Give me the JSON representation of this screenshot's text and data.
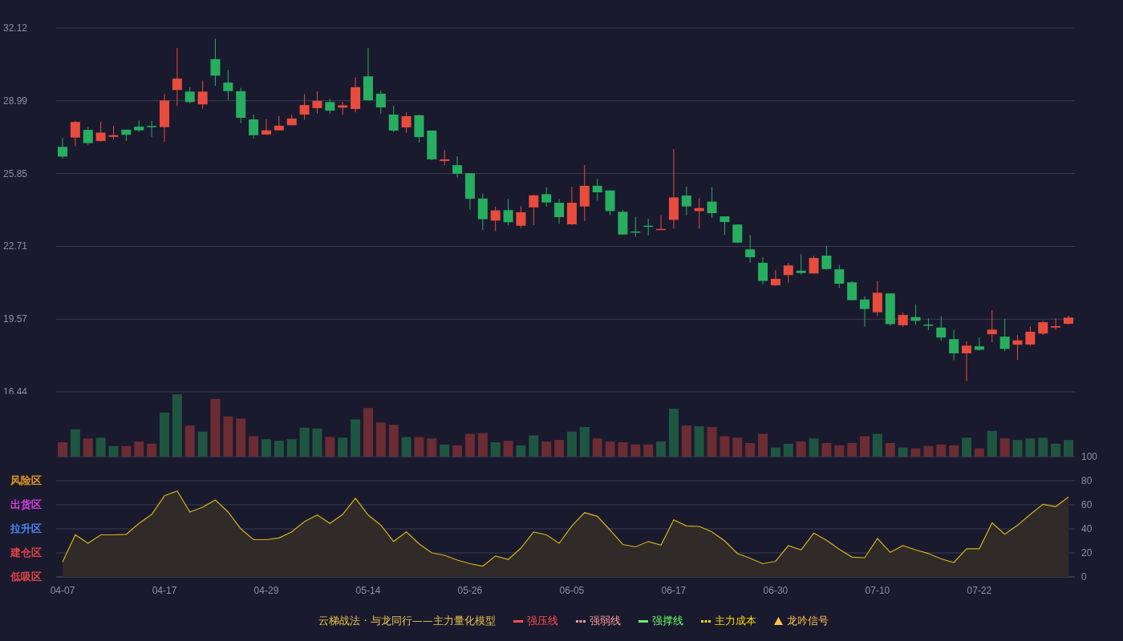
{
  "price_chart": {
    "chart_data": {
      "type": "candlestick",
      "grid": true,
      "ylim": [
        16.44,
        32.12
      ],
      "yticks": [
        32.12,
        28.99,
        25.85,
        22.71,
        19.57,
        16.44
      ],
      "categories": [
        null,
        null,
        null,
        null,
        null,
        null,
        null,
        null,
        null,
        null,
        null,
        null,
        null,
        null,
        null,
        null,
        null,
        null,
        null,
        null,
        null,
        null,
        null,
        null,
        null,
        null,
        null,
        null,
        null,
        null,
        null,
        null,
        null,
        null,
        null,
        null,
        null,
        null,
        null,
        null,
        null,
        null,
        null,
        null,
        null,
        null,
        null,
        null,
        null,
        null,
        null,
        null,
        null,
        null,
        null,
        null,
        null,
        null,
        null,
        null,
        null,
        null,
        null,
        null,
        null,
        null,
        null,
        null,
        null,
        null,
        null,
        null,
        null,
        null,
        null,
        null,
        null,
        null,
        null,
        null
      ],
      "ohlc": [
        [
          27.0,
          27.38,
          26.5,
          26.58
        ],
        [
          27.4,
          28.11,
          27.02,
          28.07
        ],
        [
          27.73,
          27.86,
          27.09,
          27.16
        ],
        [
          27.25,
          28.08,
          27.23,
          27.61
        ],
        [
          27.43,
          27.91,
          27.31,
          27.5
        ],
        [
          27.74,
          27.74,
          27.25,
          27.52
        ],
        [
          27.87,
          28.14,
          27.64,
          27.71
        ],
        [
          27.9,
          28.11,
          27.43,
          27.85
        ],
        [
          27.85,
          29.28,
          27.22,
          29.0
        ],
        [
          29.45,
          31.26,
          28.76,
          29.94
        ],
        [
          29.38,
          29.57,
          28.86,
          28.93
        ],
        [
          28.83,
          29.86,
          28.64,
          29.38
        ],
        [
          30.78,
          31.66,
          29.63,
          30.07
        ],
        [
          29.77,
          30.32,
          29.02,
          29.4
        ],
        [
          29.4,
          29.54,
          28.02,
          28.25
        ],
        [
          28.18,
          28.39,
          27.35,
          27.5
        ],
        [
          27.53,
          28.19,
          27.5,
          27.71
        ],
        [
          27.71,
          28.32,
          27.71,
          27.91
        ],
        [
          27.93,
          28.39,
          27.93,
          28.22
        ],
        [
          28.39,
          29.28,
          28.17,
          28.8
        ],
        [
          28.67,
          29.39,
          28.43,
          28.98
        ],
        [
          28.93,
          29.07,
          28.43,
          28.56
        ],
        [
          28.69,
          28.93,
          28.38,
          28.79
        ],
        [
          28.63,
          29.99,
          28.49,
          29.57
        ],
        [
          30.04,
          31.26,
          28.98,
          29.01
        ],
        [
          29.29,
          29.43,
          28.42,
          28.7
        ],
        [
          28.39,
          28.77,
          27.63,
          27.7
        ],
        [
          27.84,
          28.49,
          27.6,
          28.32
        ],
        [
          28.36,
          28.39,
          27.18,
          27.42
        ],
        [
          27.7,
          27.7,
          26.42,
          26.46
        ],
        [
          26.39,
          26.85,
          26.2,
          26.46
        ],
        [
          26.21,
          26.59,
          25.67,
          25.84
        ],
        [
          25.86,
          25.86,
          24.29,
          24.76
        ],
        [
          24.77,
          24.97,
          23.42,
          23.88
        ],
        [
          23.82,
          24.42,
          23.36,
          24.26
        ],
        [
          24.27,
          24.75,
          23.61,
          23.75
        ],
        [
          23.6,
          24.44,
          23.5,
          24.18
        ],
        [
          24.39,
          24.94,
          23.63,
          24.91
        ],
        [
          24.96,
          25.25,
          24.42,
          24.6
        ],
        [
          24.59,
          24.75,
          23.69,
          23.97
        ],
        [
          23.66,
          25.28,
          23.63,
          24.59
        ],
        [
          24.43,
          26.21,
          23.8,
          25.32
        ],
        [
          25.32,
          25.62,
          24.69,
          25.04
        ],
        [
          25.12,
          25.12,
          24.05,
          24.23
        ],
        [
          24.2,
          24.28,
          23.22,
          23.22
        ],
        [
          23.35,
          23.98,
          23.13,
          23.3
        ],
        [
          23.6,
          23.9,
          23.17,
          23.56
        ],
        [
          23.42,
          24.05,
          23.42,
          23.46
        ],
        [
          23.85,
          26.9,
          23.48,
          24.82
        ],
        [
          24.9,
          25.29,
          24.05,
          24.43
        ],
        [
          24.23,
          24.79,
          23.48,
          24.36
        ],
        [
          24.64,
          25.26,
          23.94,
          24.14
        ],
        [
          24.0,
          24.0,
          23.2,
          23.76
        ],
        [
          23.65,
          23.65,
          22.85,
          22.87
        ],
        [
          22.58,
          23.2,
          22.0,
          22.24
        ],
        [
          22.0,
          22.24,
          21.07,
          21.22
        ],
        [
          21.03,
          21.69,
          21.01,
          21.31
        ],
        [
          21.47,
          22.0,
          21.15,
          21.89
        ],
        [
          21.66,
          22.37,
          21.49,
          21.56
        ],
        [
          21.54,
          22.3,
          21.54,
          22.21
        ],
        [
          22.31,
          22.74,
          21.7,
          21.73
        ],
        [
          21.72,
          21.9,
          20.92,
          21.1
        ],
        [
          21.16,
          21.21,
          20.39,
          20.39
        ],
        [
          20.42,
          20.56,
          19.25,
          20.01
        ],
        [
          19.87,
          21.21,
          19.7,
          20.71
        ],
        [
          20.68,
          20.68,
          19.28,
          19.36
        ],
        [
          19.31,
          19.86,
          19.24,
          19.75
        ],
        [
          19.66,
          20.21,
          19.32,
          19.5
        ],
        [
          19.34,
          19.61,
          19.1,
          19.3
        ],
        [
          19.21,
          19.69,
          18.63,
          18.78
        ],
        [
          18.71,
          19.11,
          17.8,
          18.1
        ],
        [
          18.1,
          18.61,
          16.9,
          18.43
        ],
        [
          18.4,
          18.79,
          18.21,
          18.25
        ],
        [
          18.92,
          19.96,
          18.58,
          19.12
        ],
        [
          18.82,
          19.58,
          18.19,
          18.29
        ],
        [
          18.47,
          18.88,
          17.81,
          18.66
        ],
        [
          18.48,
          19.25,
          18.42,
          19.03
        ],
        [
          18.95,
          19.51,
          18.88,
          19.44
        ],
        [
          19.21,
          19.62,
          19.12,
          19.27
        ],
        [
          19.37,
          19.72,
          19.35,
          19.64
        ]
      ]
    }
  },
  "indicator_chart": {
    "chart_data": {
      "type": "area",
      "grid": true,
      "ylim": [
        0,
        100
      ],
      "yticks": [
        0,
        20,
        40,
        60,
        80,
        100
      ],
      "categories": [
        "04-07",
        null,
        null,
        null,
        null,
        null,
        null,
        null,
        "04-17",
        null,
        null,
        null,
        null,
        null,
        null,
        null,
        "04-29",
        null,
        null,
        null,
        null,
        null,
        null,
        null,
        "05-14",
        null,
        null,
        null,
        null,
        null,
        null,
        null,
        "05-26",
        null,
        null,
        null,
        null,
        null,
        null,
        null,
        "06-05",
        null,
        null,
        null,
        null,
        null,
        null,
        null,
        "06-17",
        null,
        null,
        null,
        null,
        null,
        null,
        null,
        "06-30",
        null,
        null,
        null,
        null,
        null,
        null,
        null,
        "07-10",
        null,
        null,
        null,
        null,
        null,
        null,
        null,
        "07-22",
        null,
        null,
        null,
        null,
        null,
        null,
        null
      ],
      "series": [
        {
          "color": "#d4b21a",
          "values": [
            12.5,
            35,
            28,
            35,
            35,
            35.5,
            44.5,
            52,
            67.5,
            71.5,
            54,
            58,
            64,
            54,
            40,
            31,
            31,
            32.5,
            37.5,
            46,
            51.5,
            44.5,
            52,
            65.5,
            51.5,
            43,
            29.5,
            37.5,
            27.5,
            20,
            18,
            14,
            11,
            9,
            17.5,
            14.5,
            24,
            37.5,
            35,
            28,
            42.5,
            53.5,
            50.5,
            39,
            27,
            25,
            29.5,
            26.5,
            47.5,
            42.5,
            42,
            37.5,
            30,
            19.5,
            15.5,
            11,
            13,
            26,
            22.5,
            36.5,
            30.5,
            23,
            16.5,
            16,
            32,
            20.5,
            26,
            22.5,
            19.5,
            15,
            12,
            23.5,
            23.5,
            45,
            35.5,
            43,
            52,
            60.5,
            58.5,
            66.5
          ]
        }
      ]
    },
    "zones": [
      {
        "label": "风险区",
        "color": "#f0a020"
      },
      {
        "label": "出货区",
        "color": "#e040e8"
      },
      {
        "label": "拉升区",
        "color": "#4a8cff"
      },
      {
        "label": "建仓区",
        "color": "#f04848"
      },
      {
        "label": "低吸区",
        "color": "#f04848"
      }
    ]
  },
  "legend": {
    "title": "云梯战法 · 与龙同行——主力量化模型",
    "items": [
      {
        "label": "强压线",
        "kind": "solid",
        "color": "#ff4d4f"
      },
      {
        "label": "强弱线",
        "kind": "dashed",
        "color": "#ff9a9a"
      },
      {
        "label": "强撑线",
        "kind": "solid",
        "color": "#66ff66"
      },
      {
        "label": "主力成本",
        "kind": "dashed",
        "color": "#ffd700"
      },
      {
        "label": "龙吟信号",
        "kind": "triangle",
        "color": "#ffc04d"
      }
    ]
  }
}
